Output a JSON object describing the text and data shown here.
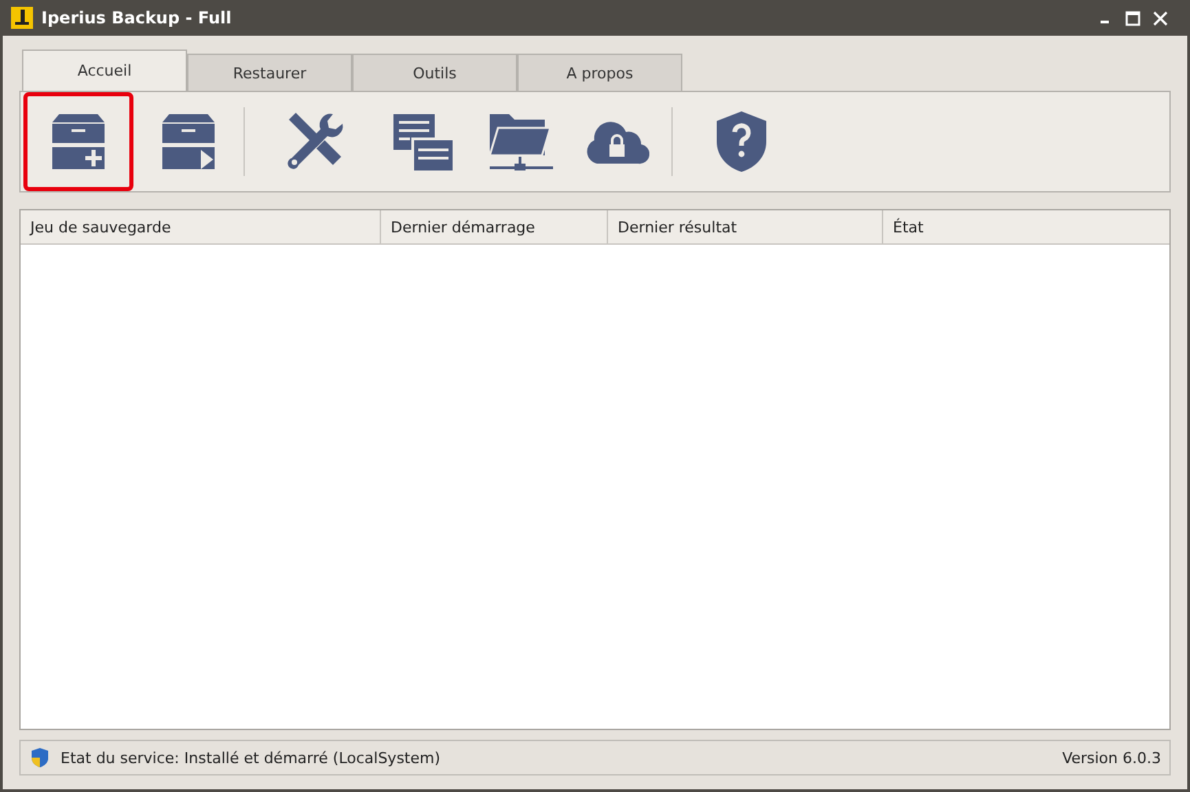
{
  "window": {
    "title": "Iperius Backup - Full"
  },
  "tabs": [
    {
      "label": "Accueil",
      "selected": true
    },
    {
      "label": "Restaurer",
      "selected": false
    },
    {
      "label": "Outils",
      "selected": false
    },
    {
      "label": "A propos",
      "selected": false
    }
  ],
  "toolbar": {
    "groups": [
      [
        {
          "kind": "new-backup",
          "selected": true
        },
        {
          "kind": "run-backup",
          "selected": false
        }
      ],
      [
        {
          "kind": "tools",
          "selected": false
        },
        {
          "kind": "log",
          "selected": false
        },
        {
          "kind": "network-folder",
          "selected": false
        },
        {
          "kind": "cloud-lock",
          "selected": false
        }
      ],
      [
        {
          "kind": "help",
          "selected": false
        }
      ]
    ]
  },
  "table": {
    "columns": [
      "Jeu de sauvegarde",
      "Dernier démarrage",
      "Dernier résultat",
      "État"
    ]
  },
  "status_bar": {
    "service": "Etat du service: Installé et démarré (LocalSystem)",
    "version": "Version 6.0.3"
  }
}
